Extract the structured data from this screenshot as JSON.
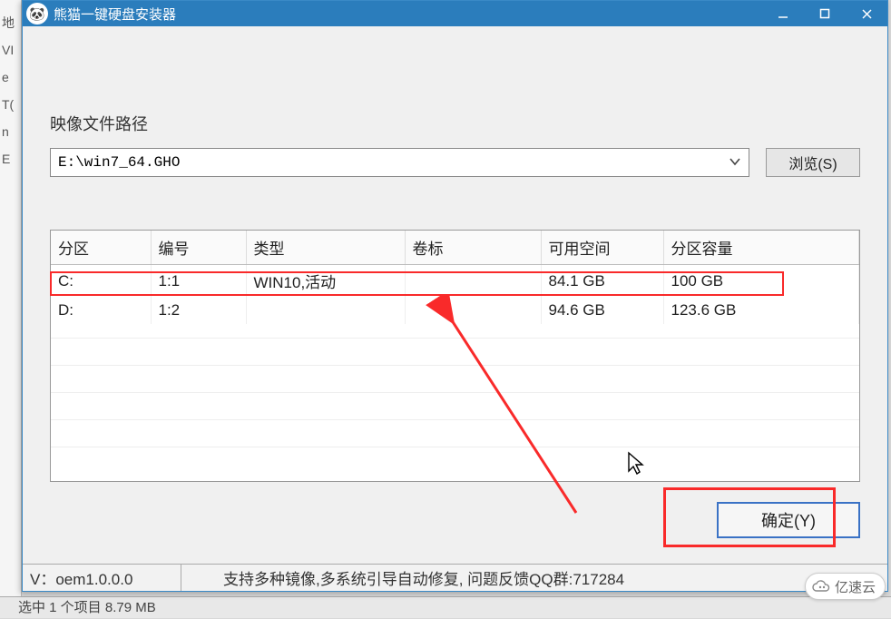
{
  "titlebar": {
    "app_name": "熊猫一键硬盘安装器"
  },
  "path": {
    "label": "映像文件路径",
    "value": "E:\\win7_64.GHO",
    "browse_label": "浏览(S)"
  },
  "table": {
    "headers": {
      "partition": "分区",
      "number": "编号",
      "type": "类型",
      "volume": "卷标",
      "free": "可用空间",
      "capacity": "分区容量"
    },
    "rows": [
      {
        "partition": "C:",
        "number": "1:1",
        "type": "WIN10,活动",
        "volume": "",
        "free": "84.1 GB",
        "capacity": "100 GB"
      },
      {
        "partition": "D:",
        "number": "1:2",
        "type": "",
        "volume": "",
        "free": "94.6 GB",
        "capacity": "123.6 GB"
      }
    ]
  },
  "buttons": {
    "ok_label": "确定(Y)"
  },
  "status": {
    "version": "V：oem1.0.0.0",
    "message": "支持多种镜像,多系统引导自动修复, 问题反馈QQ群:717284"
  },
  "bg": {
    "selection": "选中 1 个项目  8.79 MB"
  },
  "watermark": {
    "text": "亿速云"
  }
}
